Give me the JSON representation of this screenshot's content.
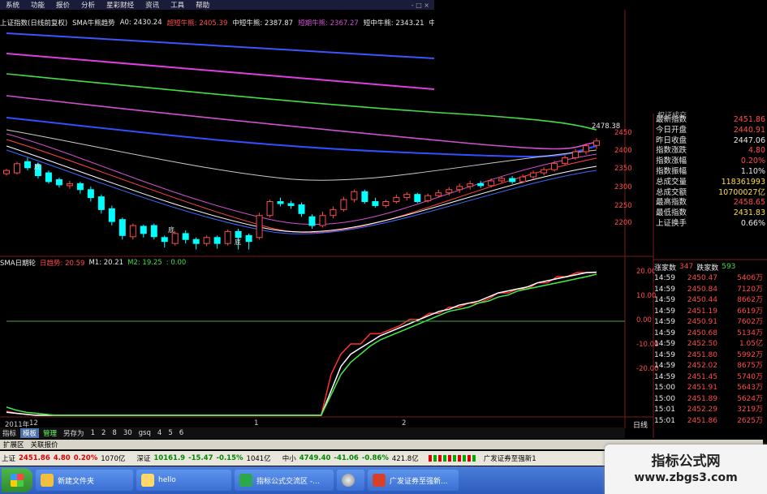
{
  "menu": {
    "items": [
      "系统",
      "功能",
      "报价",
      "分析",
      "星彩财经",
      "资讯",
      "工具",
      "帮助"
    ],
    "window_controls": "- □ ×"
  },
  "info_line": {
    "title": "上证指数(日线前复权)",
    "indicator": "SMA牛熊趋势",
    "a0": "A0: 2430.24",
    "bull1": "超短牛熊: 2405.39",
    "bull2": "中短牛熊: 2387.87",
    "bull3": "短期牛熊: 2367.27",
    "bull4": "短中牛熊: 2343.21",
    "bull5": "中长"
  },
  "price_axis": [
    "2450",
    "2400",
    "2350",
    "2300",
    "2250",
    "2200"
  ],
  "max_label": "2478.38",
  "candle_labels": [
    "底",
    "底",
    "底"
  ],
  "right_panel": {
    "header": "权证成交",
    "rows": [
      {
        "k": "最新指数",
        "v": "2451.86",
        "color": "#ff4b4b"
      },
      {
        "k": "今日开盘",
        "v": "2440.91",
        "color": "#ff4b4b"
      },
      {
        "k": "昨日收盘",
        "v": "2447.06",
        "color": "#e8e8e8"
      },
      {
        "k": "指数涨跌",
        "v": "4.80",
        "color": "#ff4b4b"
      },
      {
        "k": "指数涨幅",
        "v": "0.20%",
        "color": "#ff4b4b"
      },
      {
        "k": "指数振幅",
        "v": "1.10%",
        "color": "#e8e8e8"
      },
      {
        "k": "总成交量",
        "v": "118361993",
        "color": "#ffdd44"
      },
      {
        "k": "总成交额",
        "v": "10700027亿",
        "color": "#ffdd44"
      },
      {
        "k": "最高指数",
        "v": "2458.65",
        "color": "#ff4b4b"
      },
      {
        "k": "最低指数",
        "v": "2431.83",
        "color": "#ffdd44"
      },
      {
        "k": "上证换手",
        "v": "0.66%",
        "color": "#e8e8e8"
      }
    ]
  },
  "breadth": {
    "up_label": "涨家数",
    "up": "347",
    "down_label": "跌家数",
    "down": "593"
  },
  "trades": [
    {
      "t": "14:59",
      "p": "2450.47",
      "v": "5406万"
    },
    {
      "t": "14:59",
      "p": "2450.84",
      "v": "7120万"
    },
    {
      "t": "14:59",
      "p": "2450.44",
      "v": "8662万"
    },
    {
      "t": "14:59",
      "p": "2451.19",
      "v": "6619万"
    },
    {
      "t": "14:59",
      "p": "2450.91",
      "v": "7602万"
    },
    {
      "t": "14:59",
      "p": "2450.68",
      "v": "5134万"
    },
    {
      "t": "14:59",
      "p": "2452.50",
      "v": "1.05亿"
    },
    {
      "t": "14:59",
      "p": "2451.80",
      "v": "5992万"
    },
    {
      "t": "14:59",
      "p": "2452.02",
      "v": "8675万"
    },
    {
      "t": "14:59",
      "p": "2451.45",
      "v": "5740万"
    },
    {
      "t": "15:00",
      "p": "2451.91",
      "v": "5643万"
    },
    {
      "t": "15:00",
      "p": "2451.89",
      "v": "5624万"
    },
    {
      "t": "15:01",
      "p": "2452.29",
      "v": "3219万"
    },
    {
      "t": "15:01",
      "p": "2451.86",
      "v": "2625万"
    }
  ],
  "indicator_line": {
    "name": "SMA日期轮",
    "d": "日趋势: 20.59",
    "m1": "M1: 20.21",
    "m2": "M2: 19.25",
    "z": ": 0.00"
  },
  "ind_axis": [
    "20.00",
    "10.00",
    "0.00",
    "-10.00",
    "-20.00"
  ],
  "time_axis": {
    "year": "2011年",
    "m1": "12",
    "mark1": "1",
    "mark2": "2",
    "period": "日线"
  },
  "tabs": [
    "指标",
    "模板",
    "管理",
    "另存为",
    "1",
    "2",
    "8",
    "30",
    "gsq",
    "4",
    "5",
    "6"
  ],
  "ext_bar": [
    "扩展区",
    "关联报价"
  ],
  "status": {
    "sh_label": "上证",
    "sh_val": "2451.86",
    "sh_chg": "4.80",
    "sh_pct": "0.20%",
    "sh_amt": "1070亿",
    "sz_label": "深证",
    "sz_val": "10161.9",
    "sz_chg": "-15.47",
    "sz_pct": "-0.15%",
    "sz_amt": "1041亿",
    "zx_label": "中小",
    "zx_val": "4749.40",
    "zx_chg": "-41.06",
    "zx_pct": "-0.86%",
    "zx_amt": "421.8亿",
    "broker": "广发证券至强新1"
  },
  "taskbar": [
    "新建文件夹",
    "hello",
    "指标公式交流区 -...",
    "广发证券至强新..."
  ],
  "watermark": {
    "line1": "指标公式网",
    "line2": "www.zbgs3.com"
  },
  "colors": {
    "up": "#ff4b4b",
    "down": "#00ffff",
    "bg": "#000000",
    "green": "#44dd44"
  },
  "chart_data": {
    "type": "line",
    "title": "上证指数(日线前复权)",
    "ylim": [
      2175,
      2480
    ],
    "candles": [
      {
        "o": 2370,
        "c": 2378,
        "h": 2382,
        "l": 2365
      },
      {
        "o": 2372,
        "c": 2395,
        "h": 2400,
        "l": 2368
      },
      {
        "o": 2400,
        "c": 2385,
        "h": 2410,
        "l": 2378
      },
      {
        "o": 2392,
        "c": 2365,
        "h": 2398,
        "l": 2358
      },
      {
        "o": 2372,
        "c": 2350,
        "h": 2378,
        "l": 2345
      },
      {
        "o": 2355,
        "c": 2342,
        "h": 2360,
        "l": 2335
      },
      {
        "o": 2340,
        "c": 2345,
        "h": 2352,
        "l": 2332
      },
      {
        "o": 2345,
        "c": 2330,
        "h": 2350,
        "l": 2320
      },
      {
        "o": 2330,
        "c": 2310,
        "h": 2338,
        "l": 2300
      },
      {
        "o": 2312,
        "c": 2280,
        "h": 2318,
        "l": 2270
      },
      {
        "o": 2282,
        "c": 2250,
        "h": 2290,
        "l": 2240
      },
      {
        "o": 2255,
        "c": 2215,
        "h": 2260,
        "l": 2205
      },
      {
        "o": 2212,
        "c": 2240,
        "h": 2245,
        "l": 2205
      },
      {
        "o": 2238,
        "c": 2220,
        "h": 2242,
        "l": 2210
      },
      {
        "o": 2240,
        "c": 2212,
        "h": 2245,
        "l": 2205
      },
      {
        "o": 2210,
        "c": 2200,
        "h": 2215,
        "l": 2185
      },
      {
        "o": 2195,
        "c": 2220,
        "h": 2225,
        "l": 2190
      },
      {
        "o": 2220,
        "c": 2205,
        "h": 2228,
        "l": 2195
      },
      {
        "o": 2205,
        "c": 2195,
        "h": 2210,
        "l": 2180
      },
      {
        "o": 2195,
        "c": 2210,
        "h": 2215,
        "l": 2188
      },
      {
        "o": 2210,
        "c": 2195,
        "h": 2215,
        "l": 2182
      },
      {
        "o": 2195,
        "c": 2225,
        "h": 2230,
        "l": 2190
      },
      {
        "o": 2225,
        "c": 2210,
        "h": 2232,
        "l": 2180
      },
      {
        "o": 2215,
        "c": 2200,
        "h": 2220,
        "l": 2180
      },
      {
        "o": 2210,
        "c": 2265,
        "h": 2272,
        "l": 2205
      },
      {
        "o": 2265,
        "c": 2300,
        "h": 2305,
        "l": 2260
      },
      {
        "o": 2300,
        "c": 2295,
        "h": 2310,
        "l": 2288
      },
      {
        "o": 2295,
        "c": 2290,
        "h": 2302,
        "l": 2282
      },
      {
        "o": 2292,
        "c": 2270,
        "h": 2298,
        "l": 2262
      },
      {
        "o": 2262,
        "c": 2240,
        "h": 2268,
        "l": 2232
      },
      {
        "o": 2240,
        "c": 2265,
        "h": 2275,
        "l": 2235
      },
      {
        "o": 2265,
        "c": 2280,
        "h": 2288,
        "l": 2258
      },
      {
        "o": 2280,
        "c": 2305,
        "h": 2312,
        "l": 2275
      },
      {
        "o": 2305,
        "c": 2325,
        "h": 2330,
        "l": 2298
      },
      {
        "o": 2325,
        "c": 2300,
        "h": 2330,
        "l": 2295
      },
      {
        "o": 2300,
        "c": 2290,
        "h": 2310,
        "l": 2285
      },
      {
        "o": 2290,
        "c": 2300,
        "h": 2305,
        "l": 2284
      },
      {
        "o": 2300,
        "c": 2310,
        "h": 2318,
        "l": 2295
      },
      {
        "o": 2310,
        "c": 2318,
        "h": 2324,
        "l": 2303
      },
      {
        "o": 2318,
        "c": 2300,
        "h": 2322,
        "l": 2296
      },
      {
        "o": 2302,
        "c": 2315,
        "h": 2320,
        "l": 2298
      },
      {
        "o": 2315,
        "c": 2322,
        "h": 2330,
        "l": 2310
      },
      {
        "o": 2322,
        "c": 2330,
        "h": 2336,
        "l": 2315
      },
      {
        "o": 2330,
        "c": 2338,
        "h": 2345,
        "l": 2322
      },
      {
        "o": 2338,
        "c": 2345,
        "h": 2352,
        "l": 2330
      },
      {
        "o": 2345,
        "c": 2340,
        "h": 2352,
        "l": 2334
      },
      {
        "o": 2340,
        "c": 2352,
        "h": 2358,
        "l": 2335
      },
      {
        "o": 2352,
        "c": 2358,
        "h": 2363,
        "l": 2346
      },
      {
        "o": 2358,
        "c": 2350,
        "h": 2364,
        "l": 2344
      },
      {
        "o": 2350,
        "c": 2362,
        "h": 2368,
        "l": 2346
      },
      {
        "o": 2362,
        "c": 2372,
        "h": 2378,
        "l": 2356
      },
      {
        "o": 2372,
        "c": 2380,
        "h": 2386,
        "l": 2366
      },
      {
        "o": 2380,
        "c": 2396,
        "h": 2402,
        "l": 2375
      },
      {
        "o": 2396,
        "c": 2410,
        "h": 2416,
        "l": 2390
      },
      {
        "o": 2410,
        "c": 2425,
        "h": 2432,
        "l": 2405
      },
      {
        "o": 2425,
        "c": 2440,
        "h": 2446,
        "l": 2418
      },
      {
        "o": 2441,
        "c": 2452,
        "h": 2459,
        "l": 2432
      }
    ],
    "indicator_series": [
      {
        "name": "日趋势",
        "color": "#ff3030",
        "values": [
          -48,
          -49,
          -49.5,
          -50,
          -50,
          -50,
          -50,
          -50,
          -50,
          -50,
          -50,
          -50,
          -50,
          -50,
          -50,
          -50,
          -50,
          -50,
          -50,
          -50,
          -50,
          -50,
          -50,
          -50,
          -50,
          -50,
          -50,
          -50,
          -50,
          -50,
          -50,
          -50,
          -50,
          -30,
          -20,
          -15,
          -15,
          -10,
          -10,
          -8,
          -6,
          -3,
          -3,
          0,
          0,
          3,
          3,
          5,
          5,
          7,
          10,
          10,
          12,
          12,
          15,
          15,
          18,
          18,
          20,
          20,
          20
        ]
      },
      {
        "name": "M1",
        "color": "#ffffff",
        "values": [
          -48.5,
          -49,
          -49.5,
          -50,
          -50,
          -50,
          -50,
          -50,
          -50,
          -50,
          -50,
          -50,
          -50,
          -50,
          -50,
          -50,
          -50,
          -50,
          -50,
          -50,
          -50,
          -50,
          -50,
          -50,
          -50,
          -50,
          -50,
          -50,
          -50,
          -50,
          -50,
          -50,
          -50,
          -38,
          -26,
          -20,
          -17,
          -14,
          -11,
          -9,
          -7,
          -5,
          -3,
          -1,
          1,
          2,
          4,
          5,
          6,
          8,
          10,
          11,
          12,
          13,
          15,
          16,
          17,
          18,
          19,
          20,
          20.2
        ]
      },
      {
        "name": "M2",
        "color": "#44ee44",
        "values": [
          -46,
          -47.5,
          -48.5,
          -49,
          -49.5,
          -50,
          -50,
          -50,
          -50,
          -50,
          -50,
          -50,
          -50,
          -50,
          -50,
          -50,
          -50,
          -50,
          -50,
          -50,
          -50,
          -50,
          -50,
          -50,
          -50,
          -50,
          -50,
          -50,
          -50,
          -50,
          -50,
          -50,
          -50,
          -40,
          -30,
          -24,
          -20,
          -16,
          -13,
          -11,
          -9,
          -7,
          -5,
          -3,
          -1,
          1,
          2,
          3,
          5,
          6,
          8,
          9,
          11,
          12,
          13,
          14,
          15,
          16,
          17,
          18,
          19.2
        ]
      }
    ]
  }
}
